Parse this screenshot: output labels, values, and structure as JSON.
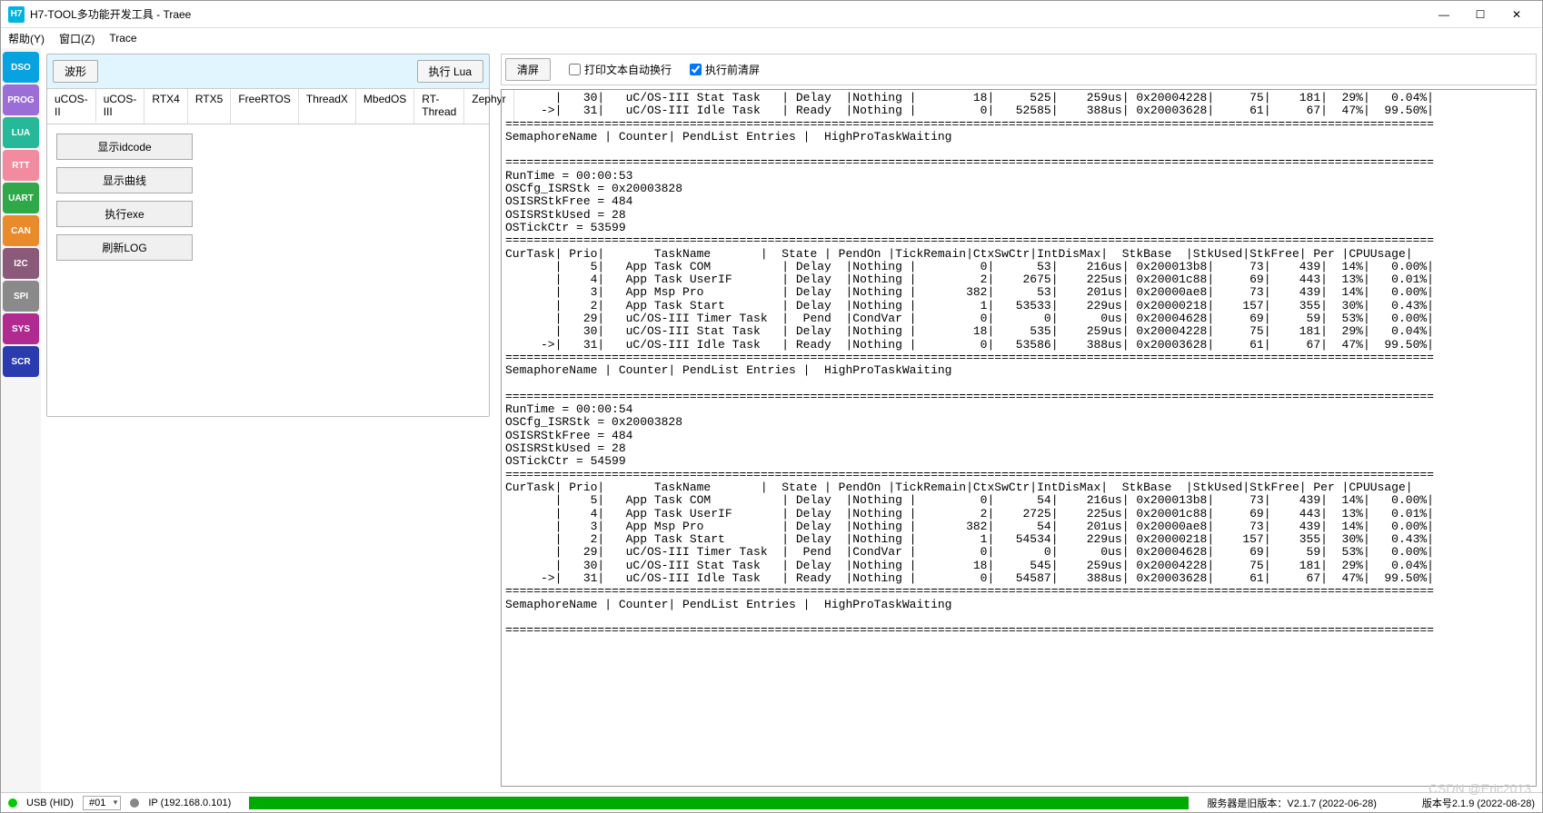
{
  "title": "H7-TOOL多功能开发工具 - Traee",
  "app_icon_text": "H7",
  "menus": [
    "帮助(Y)",
    "窗口(Z)",
    "Trace"
  ],
  "win_controls": {
    "min": "—",
    "max": "☐",
    "close": "✕"
  },
  "side_icons": [
    {
      "label": "DSO",
      "bg": "#06a3e0"
    },
    {
      "label": "PROG",
      "bg": "#9b6dd7"
    },
    {
      "label": "LUA",
      "bg": "#26b999"
    },
    {
      "label": "RTT",
      "bg": "#f28aa0"
    },
    {
      "label": "UART",
      "bg": "#2fa84a"
    },
    {
      "label": "CAN",
      "bg": "#e98b2a"
    },
    {
      "label": "I2C",
      "bg": "#8b5a7a"
    },
    {
      "label": "SPI",
      "bg": "#8a8a8a"
    },
    {
      "label": "SYS",
      "bg": "#b02a8f"
    },
    {
      "label": "SCR",
      "bg": "#2a3bb0"
    }
  ],
  "left": {
    "wave_btn": "波形",
    "run_lua_btn": "执行 Lua",
    "tabs": [
      "uCOS-II",
      "uCOS-III",
      "RTX4",
      "RTX5",
      "FreeRTOS",
      "ThreadX",
      "MbedOS",
      "RT-Thread",
      "Zephyr"
    ],
    "active_tab": 0,
    "actions": [
      "显示idcode",
      "显示曲线",
      "执行exe",
      "刷新LOG"
    ]
  },
  "right": {
    "clear_btn": "清屏",
    "cb1_label": "打印文本自动换行",
    "cb1_checked": false,
    "cb2_label": "执行前清屏",
    "cb2_checked": true
  },
  "log_blocks": [
    {
      "pre_rows": [
        {
          "cur": "",
          "prio": "30",
          "name": "uC/OS-III Stat Task",
          "state": "Delay",
          "pend": "Nothing",
          "remain": "18",
          "ctx": "525",
          "intdis": "259us",
          "stk": "0x20004228",
          "used": "75",
          "free": "181",
          "per": "29%",
          "cpu": "0.04%"
        },
        {
          "cur": "->",
          "prio": "31",
          "name": "uC/OS-III Idle Task",
          "state": "Ready",
          "pend": "Nothing",
          "remain": "0",
          "ctx": "52585",
          "intdis": "388us",
          "stk": "0x20003628",
          "used": "61",
          "free": "67",
          "per": "47%",
          "cpu": "99.50%"
        }
      ],
      "sema_line": "SemaphoreName | Counter| PendList Entries |  HighProTaskWaiting"
    },
    {
      "info": [
        "RunTime = 00:00:53",
        "OSCfg_ISRStk = 0x20003828",
        "OSISRStkFree = 484",
        "OSISRStkUsed = 28",
        "OSTickCtr = 53599"
      ],
      "header": "CurTask| Prio|       TaskName       |  State | PendOn |TickRemain|CtxSwCtr|IntDisMax|  StkBase  |StkUsed|StkFree| Per |CPUUsage|",
      "rows": [
        {
          "cur": "",
          "prio": "5",
          "name": "App Task COM",
          "state": "Delay",
          "pend": "Nothing",
          "remain": "0",
          "ctx": "53",
          "intdis": "216us",
          "stk": "0x200013b8",
          "used": "73",
          "free": "439",
          "per": "14%",
          "cpu": "0.00%"
        },
        {
          "cur": "",
          "prio": "4",
          "name": "App Task UserIF",
          "state": "Delay",
          "pend": "Nothing",
          "remain": "2",
          "ctx": "2675",
          "intdis": "225us",
          "stk": "0x20001c88",
          "used": "69",
          "free": "443",
          "per": "13%",
          "cpu": "0.01%"
        },
        {
          "cur": "",
          "prio": "3",
          "name": "App Msp Pro",
          "state": "Delay",
          "pend": "Nothing",
          "remain": "382",
          "ctx": "53",
          "intdis": "201us",
          "stk": "0x20000ae8",
          "used": "73",
          "free": "439",
          "per": "14%",
          "cpu": "0.00%"
        },
        {
          "cur": "",
          "prio": "2",
          "name": "App Task Start",
          "state": "Delay",
          "pend": "Nothing",
          "remain": "1",
          "ctx": "53533",
          "intdis": "229us",
          "stk": "0x20000218",
          "used": "157",
          "free": "355",
          "per": "30%",
          "cpu": "0.43%"
        },
        {
          "cur": "",
          "prio": "29",
          "name": "uC/OS-III Timer Task",
          "state": "Pend",
          "pend": "CondVar",
          "remain": "0",
          "ctx": "0",
          "intdis": "0us",
          "stk": "0x20004628",
          "used": "69",
          "free": "59",
          "per": "53%",
          "cpu": "0.00%"
        },
        {
          "cur": "",
          "prio": "30",
          "name": "uC/OS-III Stat Task",
          "state": "Delay",
          "pend": "Nothing",
          "remain": "18",
          "ctx": "535",
          "intdis": "259us",
          "stk": "0x20004228",
          "used": "75",
          "free": "181",
          "per": "29%",
          "cpu": "0.04%"
        },
        {
          "cur": "->",
          "prio": "31",
          "name": "uC/OS-III Idle Task",
          "state": "Ready",
          "pend": "Nothing",
          "remain": "0",
          "ctx": "53586",
          "intdis": "388us",
          "stk": "0x20003628",
          "used": "61",
          "free": "67",
          "per": "47%",
          "cpu": "99.50%"
        }
      ],
      "sema_line": "SemaphoreName | Counter| PendList Entries |  HighProTaskWaiting"
    },
    {
      "info": [
        "RunTime = 00:00:54",
        "OSCfg_ISRStk = 0x20003828",
        "OSISRStkFree = 484",
        "OSISRStkUsed = 28",
        "OSTickCtr = 54599"
      ],
      "header": "CurTask| Prio|       TaskName       |  State | PendOn |TickRemain|CtxSwCtr|IntDisMax|  StkBase  |StkUsed|StkFree| Per |CPUUsage|",
      "rows": [
        {
          "cur": "",
          "prio": "5",
          "name": "App Task COM",
          "state": "Delay",
          "pend": "Nothing",
          "remain": "0",
          "ctx": "54",
          "intdis": "216us",
          "stk": "0x200013b8",
          "used": "73",
          "free": "439",
          "per": "14%",
          "cpu": "0.00%"
        },
        {
          "cur": "",
          "prio": "4",
          "name": "App Task UserIF",
          "state": "Delay",
          "pend": "Nothing",
          "remain": "2",
          "ctx": "2725",
          "intdis": "225us",
          "stk": "0x20001c88",
          "used": "69",
          "free": "443",
          "per": "13%",
          "cpu": "0.01%"
        },
        {
          "cur": "",
          "prio": "3",
          "name": "App Msp Pro",
          "state": "Delay",
          "pend": "Nothing",
          "remain": "382",
          "ctx": "54",
          "intdis": "201us",
          "stk": "0x20000ae8",
          "used": "73",
          "free": "439",
          "per": "14%",
          "cpu": "0.00%"
        },
        {
          "cur": "",
          "prio": "2",
          "name": "App Task Start",
          "state": "Delay",
          "pend": "Nothing",
          "remain": "1",
          "ctx": "54534",
          "intdis": "229us",
          "stk": "0x20000218",
          "used": "157",
          "free": "355",
          "per": "30%",
          "cpu": "0.43%"
        },
        {
          "cur": "",
          "prio": "29",
          "name": "uC/OS-III Timer Task",
          "state": "Pend",
          "pend": "CondVar",
          "remain": "0",
          "ctx": "0",
          "intdis": "0us",
          "stk": "0x20004628",
          "used": "69",
          "free": "59",
          "per": "53%",
          "cpu": "0.00%"
        },
        {
          "cur": "",
          "prio": "30",
          "name": "uC/OS-III Stat Task",
          "state": "Delay",
          "pend": "Nothing",
          "remain": "18",
          "ctx": "545",
          "intdis": "259us",
          "stk": "0x20004228",
          "used": "75",
          "free": "181",
          "per": "29%",
          "cpu": "0.04%"
        },
        {
          "cur": "->",
          "prio": "31",
          "name": "uC/OS-III Idle Task",
          "state": "Ready",
          "pend": "Nothing",
          "remain": "0",
          "ctx": "54587",
          "intdis": "388us",
          "stk": "0x20003628",
          "used": "61",
          "free": "67",
          "per": "47%",
          "cpu": "99.50%"
        }
      ],
      "sema_line": "SemaphoreName | Counter| PendList Entries |  HighProTaskWaiting"
    }
  ],
  "status": {
    "usb": "USB (HID)",
    "combo": "#01",
    "ip": "IP (192.168.0.101)",
    "server_text": "服务器是旧版本：V2.1.7 (2022-06-28)",
    "right_text": "版本号2.1.9 (2022-08-28)"
  },
  "watermark": "CSDN @Eric2013"
}
